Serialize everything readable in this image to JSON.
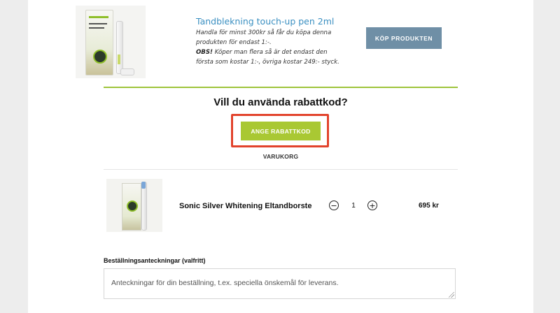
{
  "upsell": {
    "title": "Tandblekning touch-up pen 2ml",
    "description_line1": "Handla för minst 300kr så får du köpa denna produkten för endast 1:-.",
    "obs_label": "OBS!",
    "description_line2": " Köper man flera så är det endast den första som kostar 1:-, övriga kostar 249:- styck.",
    "buy_button": "KÖP PRODUKTEN",
    "image_icon": "whitening-pen-product-image"
  },
  "coupon": {
    "heading": "Vill du använda rabattkod?",
    "button": "ANGE RABATTKOD",
    "highlight_color": "#e2432c",
    "button_color": "#a9c833"
  },
  "cart": {
    "label": "VARUKORG",
    "items": [
      {
        "name": "Sonic Silver Whitening Eltandborste",
        "quantity": "1",
        "price": "695 kr",
        "minus_symbol": "−",
        "plus_symbol": "+"
      }
    ]
  },
  "notes": {
    "label": "Beställningsanteckningar (valfritt)",
    "placeholder": "Anteckningar för din beställning, t.ex. speciella önskemål för leverans."
  },
  "colors": {
    "accent_green": "#9ec43a",
    "buy_button_bg": "#6f8fa6",
    "title_blue": "#3a8fc1"
  }
}
